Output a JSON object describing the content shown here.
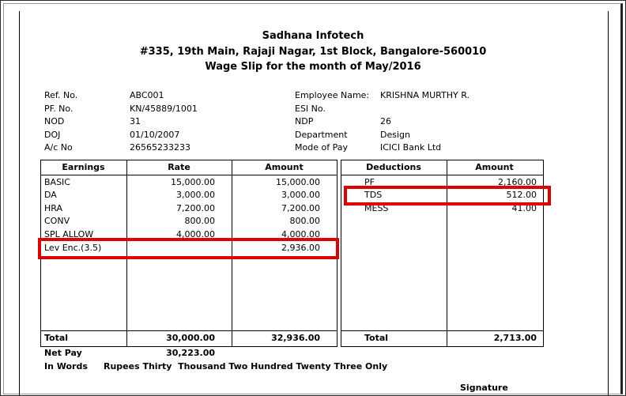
{
  "company": {
    "name": "Sadhana Infotech",
    "address": "#335, 19th Main, Rajaji Nagar, 1st Block, Bangalore-560010",
    "slip_title": "Wage Slip for the month of May/2016"
  },
  "info_left": [
    {
      "label": "Ref. No.",
      "value": "ABC001"
    },
    {
      "label": "PF. No.",
      "value": "KN/45889/1001"
    },
    {
      "label": "NOD",
      "value": "31"
    },
    {
      "label": "DOJ",
      "value": "01/10/2007"
    },
    {
      "label": "A/c No",
      "value": "26565233233"
    }
  ],
  "info_right": [
    {
      "label": "Employee Name:",
      "value": "KRISHNA MURTHY R."
    },
    {
      "label": "ESI No.",
      "value": ""
    },
    {
      "label": "NDP",
      "value": "26"
    },
    {
      "label": "Department",
      "value": "Design"
    },
    {
      "label": "Mode of Pay",
      "value": "ICICI Bank Ltd"
    }
  ],
  "earnings": {
    "headers": {
      "earnings": "Earnings",
      "rate": "Rate",
      "amount": "Amount"
    },
    "rows": [
      {
        "name": "BASIC",
        "rate": "15,000.00",
        "amount": "15,000.00"
      },
      {
        "name": "DA",
        "rate": "3,000.00",
        "amount": "3,000.00"
      },
      {
        "name": "HRA",
        "rate": "7,200.00",
        "amount": "7,200.00"
      },
      {
        "name": "CONV",
        "rate": "800.00",
        "amount": "800.00"
      },
      {
        "name": "SPL ALLOW",
        "rate": "4,000.00",
        "amount": "4,000.00"
      },
      {
        "name": "Lev Enc.(3.5)",
        "rate": "",
        "amount": "2,936.00"
      }
    ],
    "total": {
      "label": "Total",
      "rate": "30,000.00",
      "amount": "32,936.00"
    }
  },
  "deductions": {
    "headers": {
      "deductions": "Deductions",
      "amount": "Amount"
    },
    "rows": [
      {
        "name": "PF",
        "amount": "2,160.00"
      },
      {
        "name": "TDS",
        "amount": "512.00"
      },
      {
        "name": "MESS",
        "amount": "41.00"
      }
    ],
    "total": {
      "label": "Total",
      "amount": "2,713.00"
    }
  },
  "net_pay": {
    "label": "Net Pay",
    "value": "30,223.00"
  },
  "in_words": {
    "label": "In Words",
    "value": "Rupees Thirty  Thousand Two Hundred Twenty Three Only"
  },
  "signature": "Signature",
  "highlight_color": "#e00000"
}
